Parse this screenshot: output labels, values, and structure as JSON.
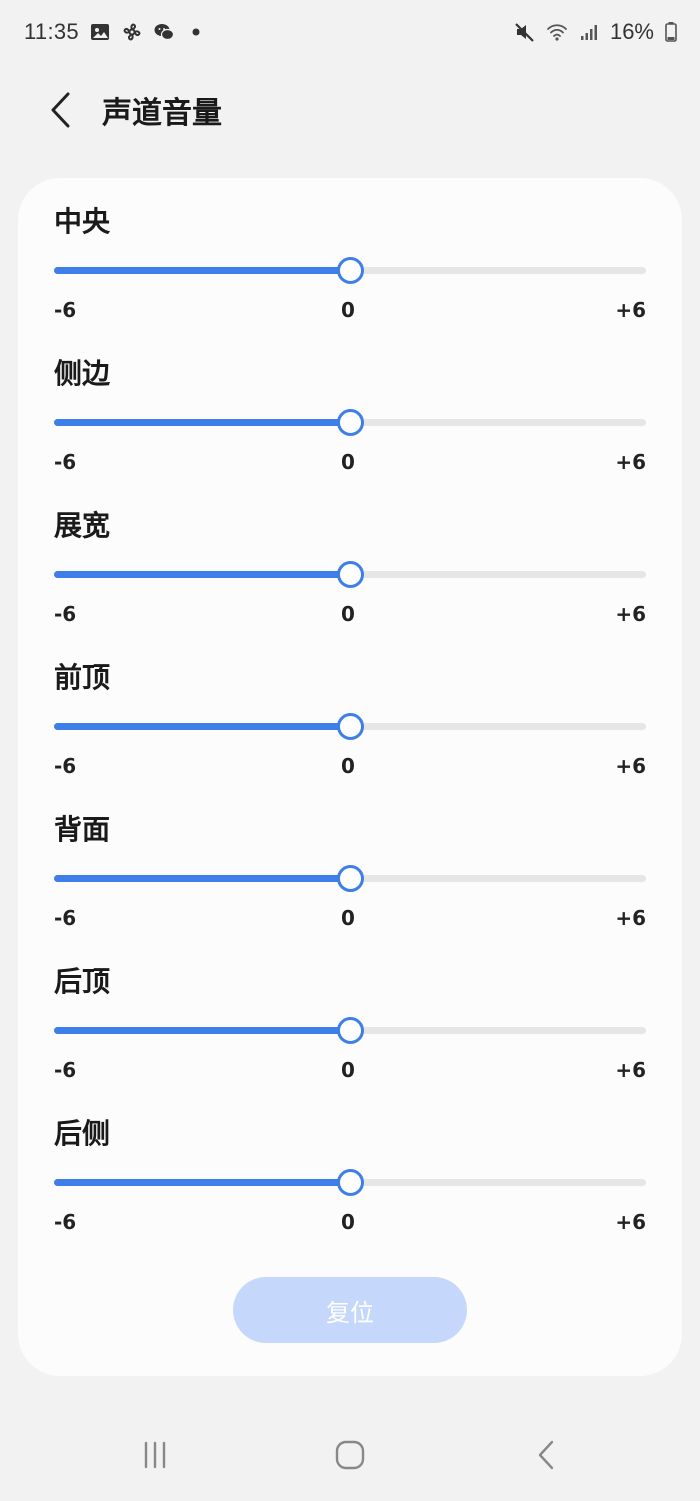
{
  "status_bar": {
    "time": "11:35",
    "battery": "16%",
    "left_icons": [
      "gallery-icon",
      "pinwheel-icon",
      "wechat-icon",
      "dot-icon"
    ],
    "right_icons": [
      "mute-icon",
      "wifi-icon",
      "signal-icon"
    ]
  },
  "header": {
    "title": "声道音量",
    "back_icon": "chevron-left-icon"
  },
  "sliders": [
    {
      "label": "中央",
      "min": "-6",
      "mid": "0",
      "max": "+6",
      "value": 0
    },
    {
      "label": "侧边",
      "min": "-6",
      "mid": "0",
      "max": "+6",
      "value": 0
    },
    {
      "label": "展宽",
      "min": "-6",
      "mid": "0",
      "max": "+6",
      "value": 0
    },
    {
      "label": "前顶",
      "min": "-6",
      "mid": "0",
      "max": "+6",
      "value": 0
    },
    {
      "label": "背面",
      "min": "-6",
      "mid": "0",
      "max": "+6",
      "value": 0
    },
    {
      "label": "后顶",
      "min": "-6",
      "mid": "0",
      "max": "+6",
      "value": 0
    },
    {
      "label": "后侧",
      "min": "-6",
      "mid": "0",
      "max": "+6",
      "value": 0
    }
  ],
  "reset_label": "复位",
  "colors": {
    "accent": "#3d7ee8",
    "reset_button": "#c5d8fb"
  },
  "nav_bar": {
    "icons": [
      "recent-apps-icon",
      "home-icon",
      "back-icon"
    ]
  }
}
